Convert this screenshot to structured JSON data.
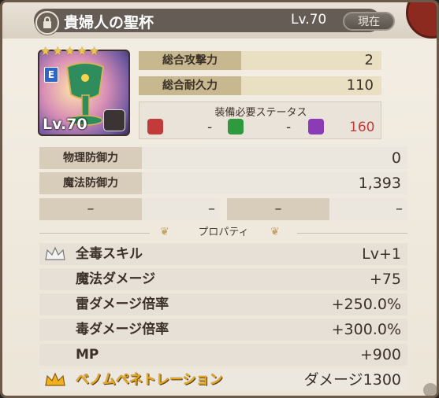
{
  "header": {
    "title": "貴婦人の聖杯",
    "level": "Lv.70",
    "now_button": "現在"
  },
  "weapon": {
    "rarity_stars": "★★★★★",
    "element_badge": "E",
    "level": "Lv.70"
  },
  "stats": {
    "attack_label": "総合攻撃力",
    "attack_value": "2",
    "durability_label": "総合耐久力",
    "durability_value": "110"
  },
  "requirements": {
    "title": "装備必要ステータス",
    "items": [
      {
        "icon": "fist-icon",
        "value": "-",
        "color": "#c23a3a"
      },
      {
        "icon": "star-clover-icon",
        "value": "-",
        "color": "#2f9a3d"
      },
      {
        "icon": "magic-wand-icon",
        "value": "160",
        "color": "#8b3bb5"
      }
    ]
  },
  "defense": {
    "physical_label": "物理防御力",
    "physical_value": "0",
    "magic_label": "魔法防御力",
    "magic_value": "1,393",
    "empty_left_a": "–",
    "empty_left_b": "–",
    "empty_right_a": "–",
    "empty_right_b": "–"
  },
  "properties": {
    "header": "プロパティ",
    "items": [
      {
        "name": "全毒スキル",
        "value": "Lv+1",
        "icon": "crown-icon"
      },
      {
        "name": "魔法ダメージ",
        "value": "+75",
        "icon": ""
      },
      {
        "name": "雷ダメージ倍率",
        "value": "+250.0%",
        "icon": ""
      },
      {
        "name": "毒ダメージ倍率",
        "value": "+300.0%",
        "icon": ""
      },
      {
        "name": "MP",
        "value": "+900",
        "icon": ""
      },
      {
        "name": "ベノムペネトレーション",
        "value": "ダメージ1300",
        "icon": "gold-crown-icon"
      }
    ]
  },
  "colors": {
    "panel_label": "#c8b88f",
    "panel_value": "#e9dfc3",
    "text": "#3b3128",
    "accent_gold": "#e5a91d",
    "red_value": "#c23a3a"
  }
}
